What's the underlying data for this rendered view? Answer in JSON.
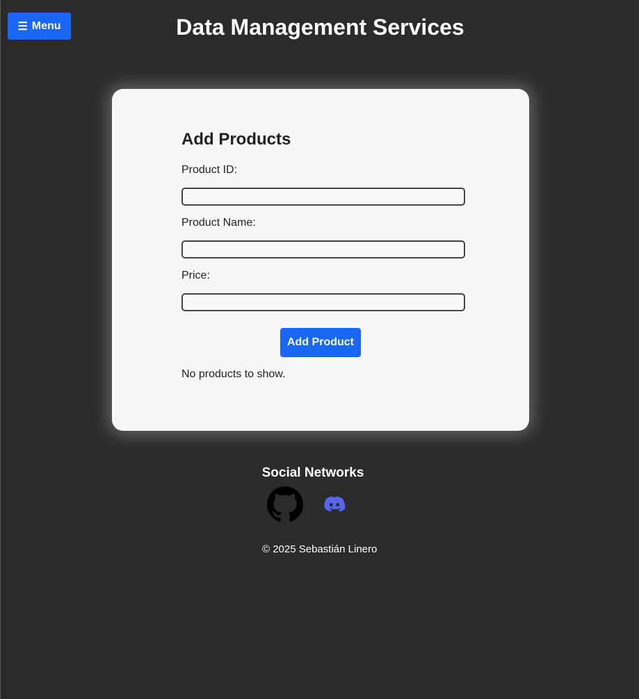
{
  "header": {
    "menu_icon": "☰",
    "menu_label": "Menu",
    "title": "Data Management Services"
  },
  "form": {
    "title": "Add Products",
    "fields": [
      {
        "label": "Product ID:",
        "value": "",
        "placeholder": ""
      },
      {
        "label": "Product Name:",
        "value": "",
        "placeholder": ""
      },
      {
        "label": "Price:",
        "value": "",
        "placeholder": ""
      }
    ],
    "submit_label": "Add Product",
    "empty_message": "No products to show."
  },
  "footer": {
    "social_heading": "Social Networks",
    "social_icons": [
      "github-icon",
      "discord-icon"
    ],
    "copyright": "© 2025 Sebastián Linero"
  },
  "colors": {
    "page_background": "#2b2b2b",
    "card_background": "#f7f7f7",
    "accent": "#1a66f5",
    "discord": "#5865f2"
  }
}
